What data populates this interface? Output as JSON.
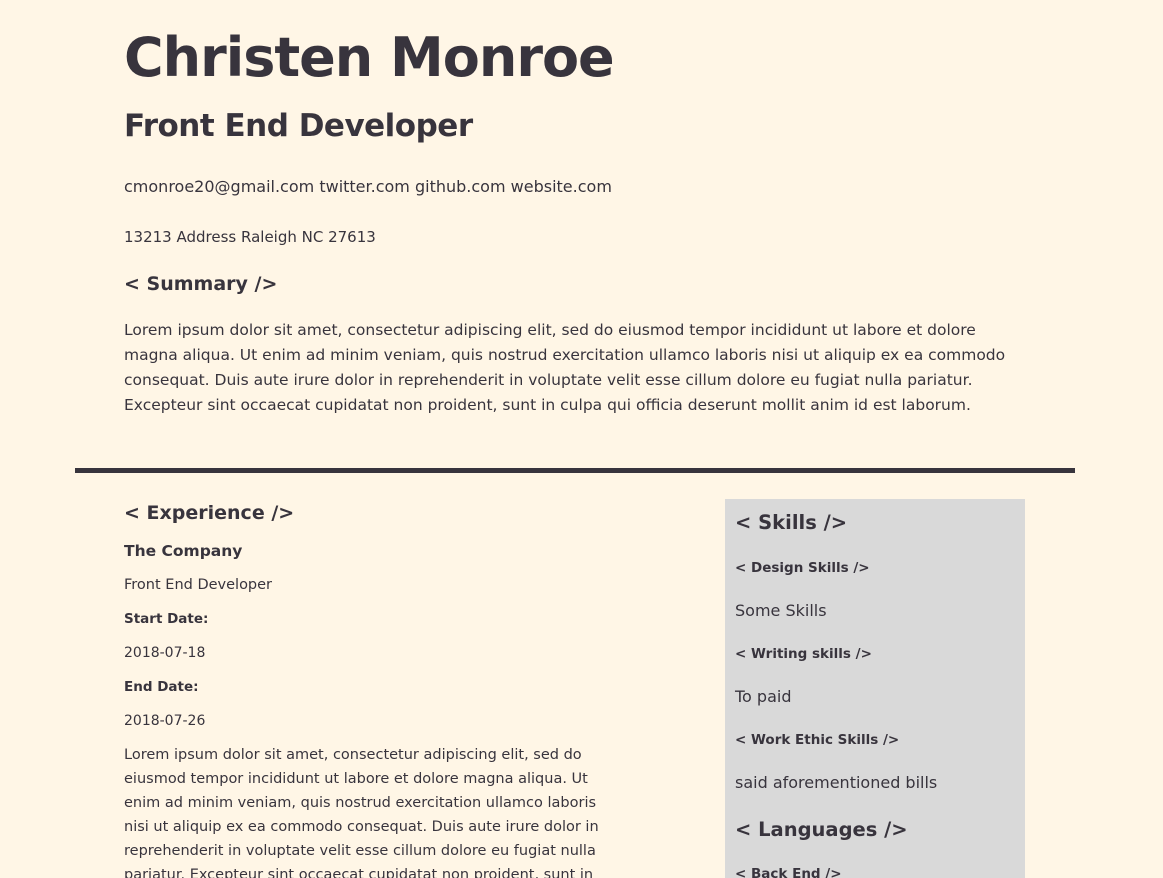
{
  "header": {
    "name": "Christen Monroe",
    "title": "Front End Developer",
    "email": "cmonroe20@gmail.com",
    "twitter": "twitter.com",
    "github": "github.com",
    "website": "website.com",
    "address": "13213 Address Raleigh NC 27613"
  },
  "summary": {
    "heading": "< Summary />",
    "text": "Lorem ipsum dolor sit amet, consectetur adipiscing elit, sed do eiusmod tempor incididunt ut labore et dolore magna aliqua. Ut enim ad minim veniam, quis nostrud exercitation ullamco laboris nisi ut aliquip ex ea commodo consequat. Duis aute irure dolor in reprehenderit in voluptate velit esse cillum dolore eu fugiat nulla pariatur. Excepteur sint occaecat cupidatat non proident, sunt in culpa qui officia deserunt mollit anim id est laborum."
  },
  "experience": {
    "heading": "< Experience />",
    "company": "The Company",
    "position": "Front End Developer",
    "start_label": "Start Date:",
    "start_value": "2018-07-18",
    "end_label": "End Date:",
    "end_value": "2018-07-26",
    "description": "Lorem ipsum dolor sit amet, consectetur adipiscing elit, sed do eiusmod tempor incididunt ut labore et dolore magna aliqua. Ut enim ad minim veniam, quis nostrud exercitation ullamco laboris nisi ut aliquip ex ea commodo consequat. Duis aute irure dolor in reprehenderit in voluptate velit esse cillum dolore eu fugiat nulla pariatur. Excepteur sint occaecat cupidatat non proident, sunt in"
  },
  "skills": {
    "heading": "< Skills />",
    "design_label": "< Design Skills />",
    "design_value": "Some Skills",
    "writing_label": "< Writing skills />",
    "writing_value": "To paid",
    "ethic_label": "< Work Ethic Skills />",
    "ethic_value": "said aforementioned bills"
  },
  "languages": {
    "heading": "< Languages />",
    "backend_label": "< Back End />"
  }
}
